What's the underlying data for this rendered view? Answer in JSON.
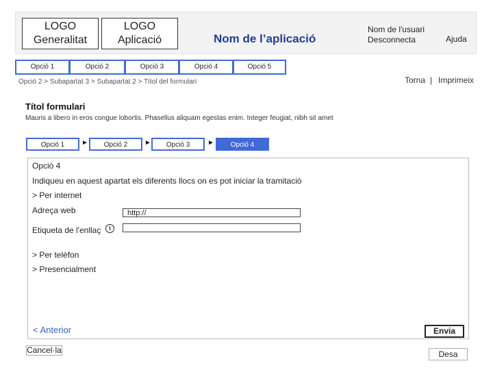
{
  "header": {
    "logo_generalitat": [
      "LOGO",
      "Generalitat"
    ],
    "logo_aplicacio": [
      "LOGO",
      "Aplicació"
    ],
    "app_name": "Nom de l’aplicació",
    "user_name": "Nom de l'usuari",
    "logout": "Desconnecta",
    "help": "Ajuda"
  },
  "nav": {
    "items": [
      {
        "label": "Opció 1"
      },
      {
        "label": "Opció 2"
      },
      {
        "label": "Opció 3"
      },
      {
        "label": "Opció 4"
      },
      {
        "label": "Opció 5"
      }
    ]
  },
  "breadcrumb": "Opció 2 > Subapartat 3 > Subapartat 2 > Títol del formulari",
  "top_links": {
    "back": "Torna",
    "separator": "|",
    "print": "Imprimeix"
  },
  "form": {
    "title": "Títol formulari",
    "description": "Mauris a libero in eros congue lobortis. Phasellus aliquam egestas enim. Integer feugiat, nibh sit amet",
    "steps": [
      {
        "label": "Opció 1",
        "active": false
      },
      {
        "label": "Opció 2",
        "active": false
      },
      {
        "label": "Opció 3",
        "active": false
      },
      {
        "label": "Opció 4",
        "active": true
      }
    ],
    "step_arrow": "►",
    "panel": {
      "heading": "Opció 4",
      "intro": "Indiqueu en aquest apartat els diferents llocs on es pot iniciar la tramitació",
      "section_internet": "> Per internet",
      "web_label": "Adreça web",
      "web_value": "http://",
      "link_label": "Etiqueta de l'enllaç",
      "link_value": "",
      "info_icon": "i",
      "section_phone": "> Per telèfon",
      "section_inperson": "> Presencialment",
      "previous": "< Anterior",
      "send": "Envia"
    },
    "cancel": "Cancel·la",
    "save": "Desa"
  },
  "colors": {
    "accent": "#3f6ad8",
    "app_name": "#1f3f96",
    "link": "#3a5fbf"
  }
}
